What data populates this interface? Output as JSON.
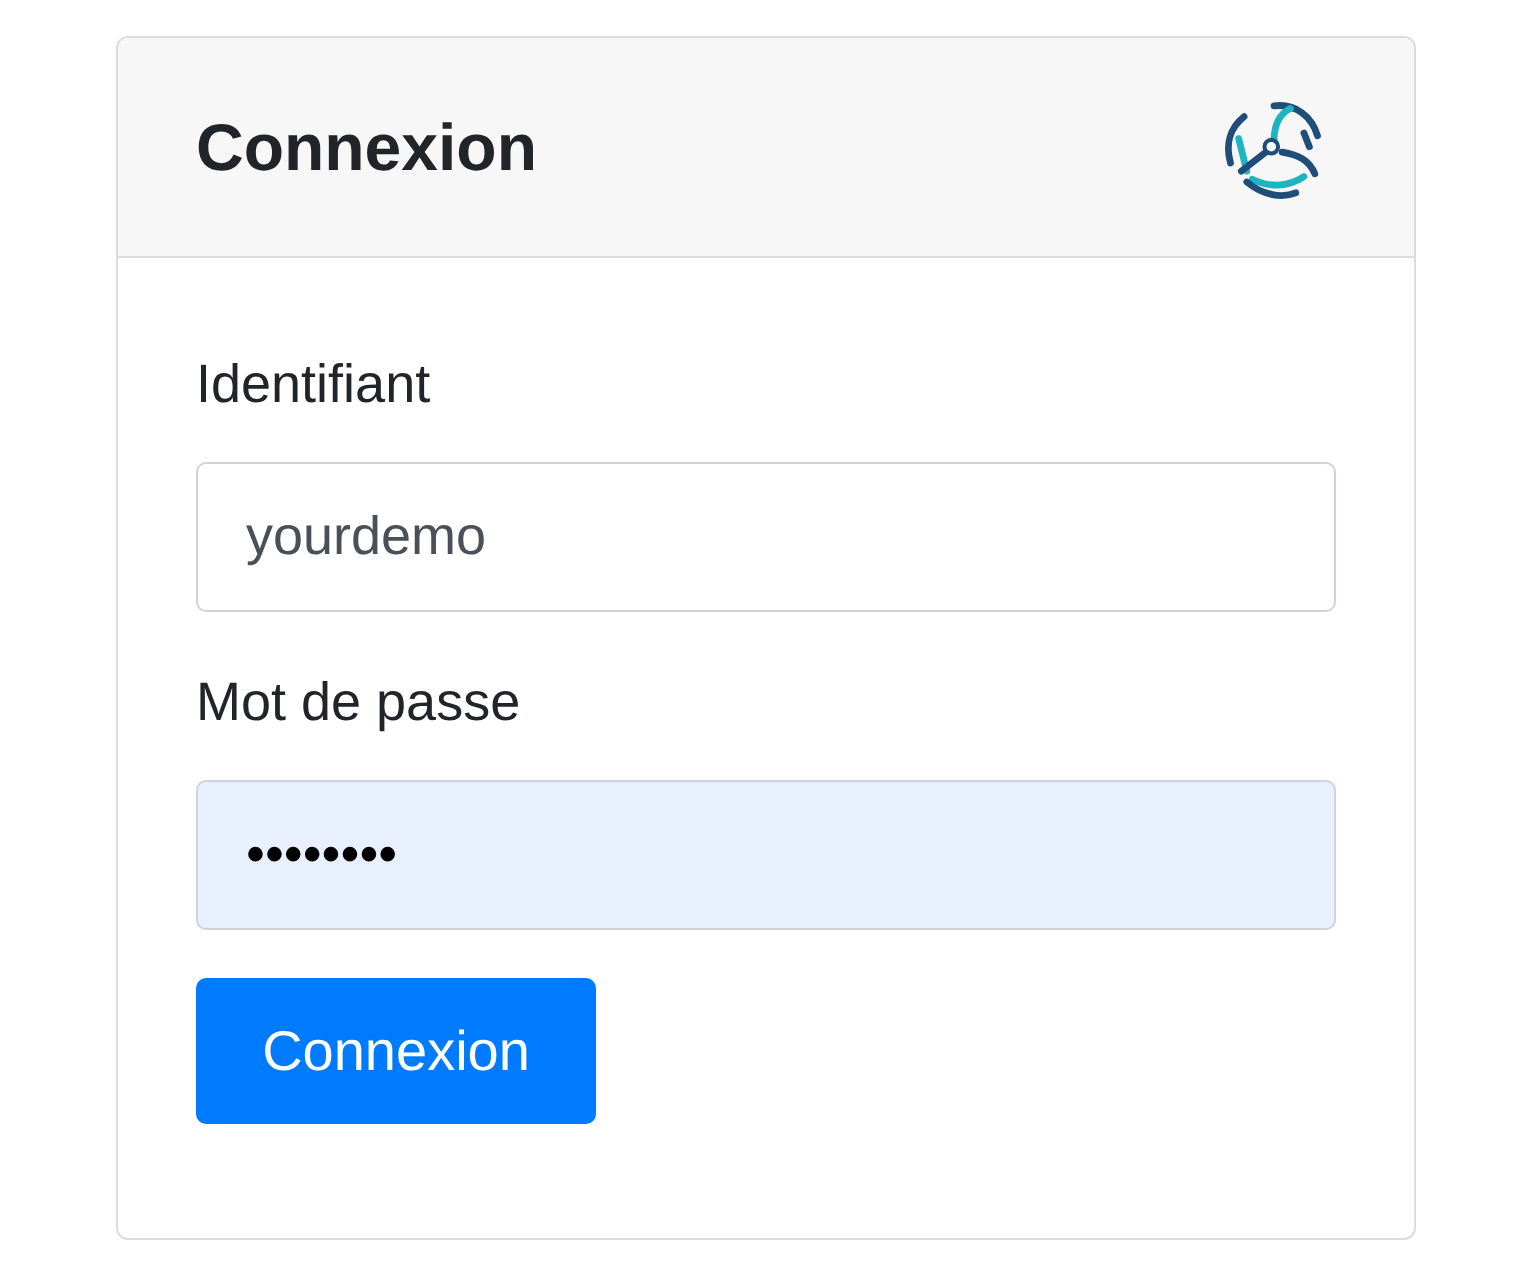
{
  "card": {
    "title": "Connexion"
  },
  "fields": [
    {
      "label": "Identifiant",
      "value": "yourdemo",
      "autofilled": false
    },
    {
      "label": "Mot de passe",
      "value": "••••••••",
      "autofilled": true
    }
  ],
  "submit": {
    "label": "Connexion"
  }
}
